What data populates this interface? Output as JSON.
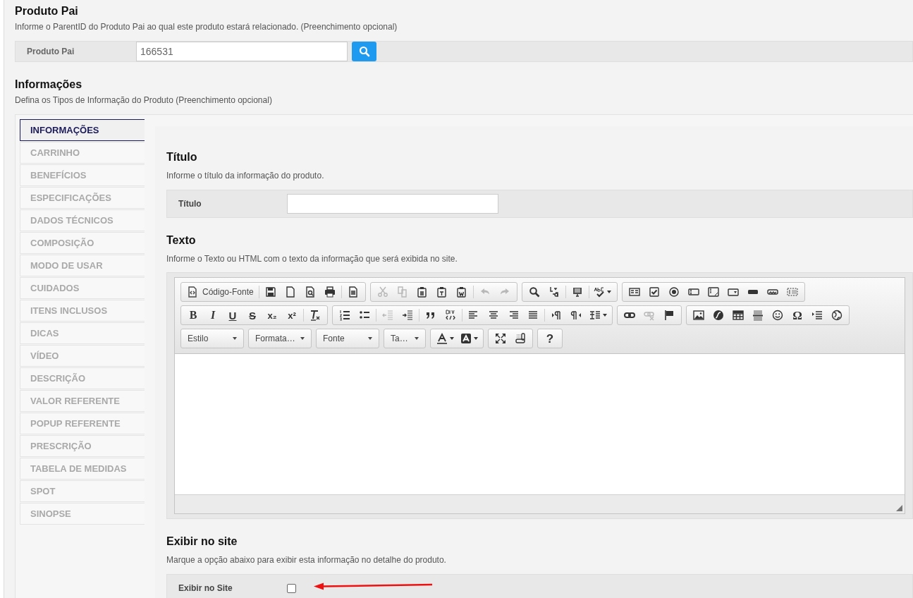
{
  "parent_section": {
    "title": "Produto Pai",
    "description": "Informe o ParentID do Produto Pai ao qual este produto estará relacionado. (Preenchimento opcional)",
    "field_label": "Produto Pai",
    "field_value": "166531"
  },
  "info_section": {
    "title": "Informações",
    "description": "Defina os Tipos de Informação do Produto (Preenchimento opcional)"
  },
  "tabs": [
    {
      "label": "INFORMAÇÕES",
      "selected": true
    },
    {
      "label": "CARRINHO",
      "selected": false
    },
    {
      "label": "BENEFÍCIOS",
      "selected": false
    },
    {
      "label": "ESPECIFICAÇÕES",
      "selected": false
    },
    {
      "label": "DADOS TÉCNICOS",
      "selected": false
    },
    {
      "label": "COMPOSIÇÃO",
      "selected": false
    },
    {
      "label": "MODO DE USAR",
      "selected": false
    },
    {
      "label": "CUIDADOS",
      "selected": false
    },
    {
      "label": "ITENS INCLUSOS",
      "selected": false
    },
    {
      "label": "DICAS",
      "selected": false
    },
    {
      "label": "VÍDEO",
      "selected": false
    },
    {
      "label": "DESCRIÇÃO",
      "selected": false
    },
    {
      "label": "VALOR REFERENTE",
      "selected": false
    },
    {
      "label": "POPUP REFERENTE",
      "selected": false
    },
    {
      "label": "PRESCRIÇÃO",
      "selected": false
    },
    {
      "label": "TABELA DE MEDIDAS",
      "selected": false
    },
    {
      "label": "SPOT",
      "selected": false
    },
    {
      "label": "SINOPSE",
      "selected": false
    }
  ],
  "title_section": {
    "title": "Título",
    "description": "Informe o título da informação do produto.",
    "field_label": "Título"
  },
  "text_section": {
    "title": "Texto",
    "description": "Informe o Texto ou HTML com o texto da informação que será exibida no site."
  },
  "toolbar_rows": [
    [
      [
        [
          {
            "kind": "source",
            "label": "Código-Fonte",
            "disabled": false
          }
        ],
        [
          {
            "kind": "save",
            "disabled": false
          },
          {
            "kind": "newpage",
            "disabled": false
          },
          {
            "kind": "preview",
            "disabled": false
          },
          {
            "kind": "print",
            "disabled": false
          }
        ],
        [
          {
            "kind": "templates",
            "disabled": false
          }
        ]
      ],
      [
        [
          {
            "kind": "cut",
            "disabled": true
          },
          {
            "kind": "copy",
            "disabled": true
          },
          {
            "kind": "paste",
            "disabled": false
          },
          {
            "kind": "pastetext",
            "disabled": false
          },
          {
            "kind": "pasteword",
            "disabled": false
          }
        ],
        [
          {
            "kind": "undo",
            "disabled": true
          },
          {
            "kind": "redo",
            "disabled": true
          }
        ]
      ],
      [
        [
          {
            "kind": "find",
            "disabled": false
          },
          {
            "kind": "replace",
            "disabled": false
          }
        ],
        [
          {
            "kind": "selectall",
            "disabled": false
          }
        ],
        [
          {
            "kind": "spellcheck",
            "disabled": false,
            "menu": true
          }
        ]
      ],
      [
        [
          {
            "kind": "form",
            "disabled": false
          },
          {
            "kind": "checkbox",
            "disabled": false
          },
          {
            "kind": "radio",
            "disabled": false
          },
          {
            "kind": "textfield",
            "disabled": false
          },
          {
            "kind": "textarea",
            "disabled": false
          },
          {
            "kind": "select",
            "disabled": false
          },
          {
            "kind": "button",
            "disabled": false
          },
          {
            "kind": "imagebutton",
            "disabled": false
          },
          {
            "kind": "hiddenfield",
            "disabled": false
          }
        ]
      ]
    ],
    [
      [
        [
          {
            "kind": "bold",
            "glyph": "B",
            "disabled": false
          },
          {
            "kind": "italic",
            "glyph": "I",
            "disabled": false
          },
          {
            "kind": "underline",
            "glyph": "U",
            "disabled": false
          },
          {
            "kind": "strike",
            "glyph": "S",
            "disabled": false
          },
          {
            "kind": "subscript",
            "glyph": "x₂",
            "disabled": false
          },
          {
            "kind": "superscript",
            "glyph": "x²",
            "disabled": false
          }
        ],
        [
          {
            "kind": "removeformat",
            "disabled": false
          }
        ]
      ],
      [
        [
          {
            "kind": "numberedlist",
            "disabled": false
          },
          {
            "kind": "bulletedlist",
            "disabled": false
          }
        ],
        [
          {
            "kind": "outdent",
            "disabled": true
          },
          {
            "kind": "indent",
            "disabled": false
          }
        ],
        [
          {
            "kind": "blockquote",
            "disabled": false
          },
          {
            "kind": "creatediv",
            "disabled": false
          }
        ],
        [
          {
            "kind": "alignleft",
            "disabled": false
          },
          {
            "kind": "aligncenter",
            "disabled": false
          },
          {
            "kind": "alignright",
            "disabled": false
          },
          {
            "kind": "justify",
            "disabled": false
          }
        ],
        [
          {
            "kind": "ltr",
            "disabled": false
          },
          {
            "kind": "rtl",
            "disabled": false
          },
          {
            "kind": "language",
            "disabled": false,
            "menu": true
          }
        ]
      ],
      [
        [
          {
            "kind": "link",
            "disabled": false
          },
          {
            "kind": "unlink",
            "disabled": true
          },
          {
            "kind": "anchor",
            "disabled": false
          }
        ]
      ],
      [
        [
          {
            "kind": "image",
            "disabled": false
          },
          {
            "kind": "flash",
            "disabled": false
          },
          {
            "kind": "table",
            "disabled": false
          },
          {
            "kind": "hr",
            "disabled": false
          },
          {
            "kind": "smiley",
            "disabled": false
          },
          {
            "kind": "specialchar",
            "glyph": "Ω",
            "disabled": false
          },
          {
            "kind": "pagebreak",
            "disabled": false
          },
          {
            "kind": "iframe",
            "disabled": false
          }
        ]
      ]
    ],
    [
      [
        [
          {
            "kind": "combo",
            "label": "Estilo"
          }
        ]
      ],
      [
        [
          {
            "kind": "combo",
            "label": "Formata…"
          }
        ]
      ],
      [
        [
          {
            "kind": "combo",
            "label": "Fonte"
          }
        ]
      ],
      [
        [
          {
            "kind": "combo",
            "label": "Ta…"
          }
        ]
      ],
      [
        [
          {
            "kind": "textcolor",
            "disabled": false,
            "menu": true
          },
          {
            "kind": "bgcolor",
            "disabled": false,
            "menu": true
          }
        ]
      ],
      [
        [
          {
            "kind": "maximize",
            "disabled": false
          },
          {
            "kind": "showblocks",
            "disabled": false
          }
        ]
      ],
      [
        [
          {
            "kind": "about",
            "glyph": "?",
            "disabled": false
          }
        ]
      ]
    ]
  ],
  "display_section": {
    "title": "Exibir no site",
    "description": "Marque a opção abaixo para exibir esta informação no detalhe do produto.",
    "field_label": "Exibir no Site",
    "checked": false
  }
}
